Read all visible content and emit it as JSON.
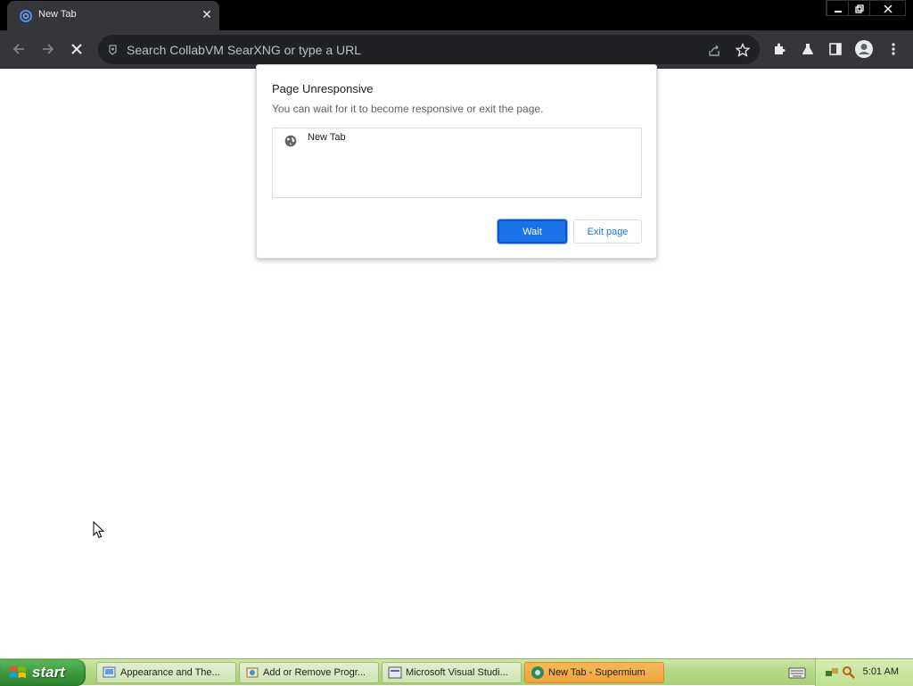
{
  "browser": {
    "tab": {
      "title": "New Tab",
      "favicon": "supermium-icon",
      "close_glyph": "✕"
    },
    "window_controls": [
      "minimize-icon",
      "restore-icon",
      "close-icon"
    ],
    "toolbar": {
      "back_icon": "arrow-left-icon",
      "forward_icon": "arrow-right-icon",
      "stop_icon": "stop-x-icon",
      "omnibox": {
        "placeholder": "Search CollabVM SearXNG or type a URL",
        "value": ""
      },
      "right_icons": [
        "share-icon",
        "star-icon",
        "extensions-icon",
        "labs-icon",
        "side-panel-icon",
        "profile-icon",
        "menu-icon"
      ]
    }
  },
  "dialog": {
    "title": "Page Unresponsive",
    "subtitle": "You can wait for it to become responsive or exit the page.",
    "list": [
      {
        "label": "New Tab",
        "icon": "globe-icon"
      }
    ],
    "wait_label": "Wait",
    "exit_label": "Exit page"
  },
  "taskbar": {
    "start_label": "start",
    "tasks": [
      {
        "label": "Appearance and The...",
        "icon": "control-panel-icon",
        "active": false
      },
      {
        "label": "Add or Remove Progr...",
        "icon": "add-remove-icon",
        "active": false
      },
      {
        "label": "Microsoft Visual Studi...",
        "icon": "installer-icon",
        "active": false
      },
      {
        "label": "New Tab - Supermium",
        "icon": "supermium-icon",
        "active": true
      }
    ],
    "clock": "5:01 AM"
  },
  "colors": {
    "accent": "#1a73e8",
    "toolbar": "#35363a",
    "omnibox": "#202124",
    "taskbar_active": "#f0a33c"
  }
}
